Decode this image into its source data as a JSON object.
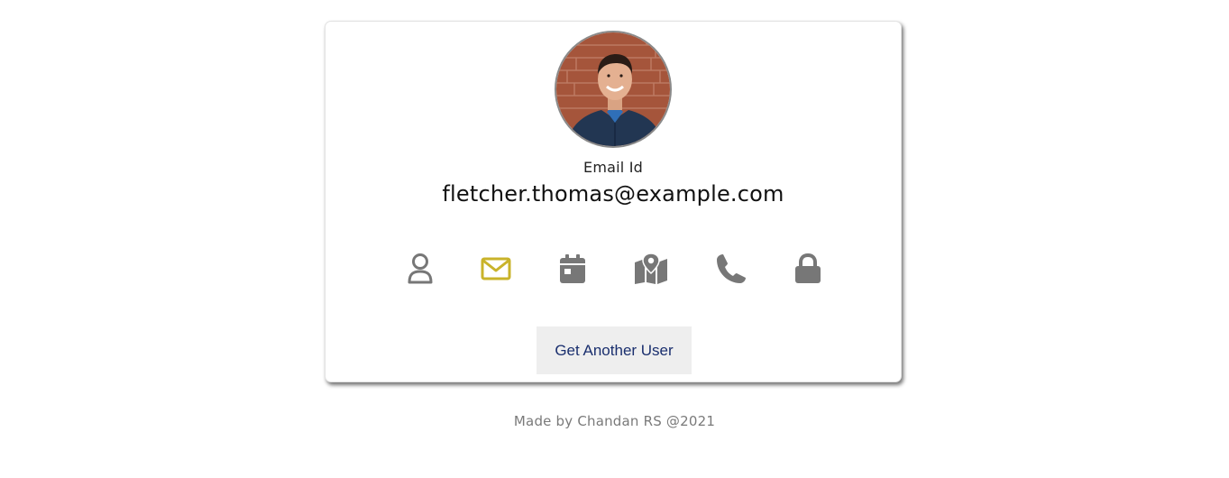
{
  "card": {
    "label": "Email Id",
    "value": "fletcher.thomas@example.com",
    "button_label": "Get Another User"
  },
  "icons": [
    {
      "name": "user-icon",
      "active": false
    },
    {
      "name": "envelope-icon",
      "active": true
    },
    {
      "name": "calendar-icon",
      "active": false
    },
    {
      "name": "map-icon",
      "active": false
    },
    {
      "name": "phone-icon",
      "active": false
    },
    {
      "name": "lock-icon",
      "active": false
    }
  ],
  "colors": {
    "icon_default": "#777777",
    "icon_active": "#c9b32a",
    "button_bg": "#eeeeee",
    "button_text": "#1a2f6e"
  },
  "footer": {
    "text": "Made by Chandan RS @2021"
  }
}
